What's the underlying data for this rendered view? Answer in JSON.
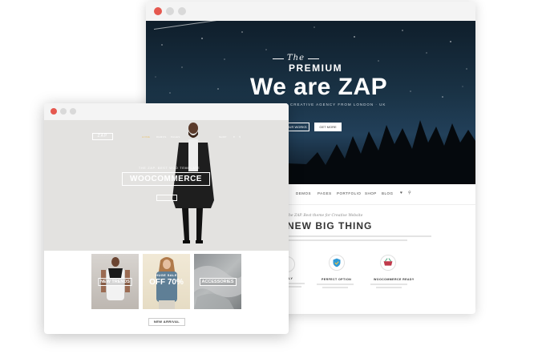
{
  "back_window": {
    "hero": {
      "script_text": "The",
      "premium": "PREMIUM",
      "headline": "We are ZAP",
      "tagline": "A CREATIVE AGENCY FROM LONDON · UK",
      "button_outline": "OUR WORKS",
      "button_fill": "GET MORE"
    },
    "nav": {
      "items": [
        "DEMOS",
        "PAGES",
        "PORTFOLIO",
        "SHOP",
        "BLOG"
      ],
      "icons": [
        "cart-icon",
        "search-icon"
      ]
    },
    "section": {
      "subtitle": "The ZAP. Best theme for Creative Website",
      "title": "NEW BIG THING",
      "features": [
        {
          "label": "FULLY",
          "icon": "support-icon"
        },
        {
          "label": "PERFECT OPTION",
          "icon": "shield-icon"
        },
        {
          "label": "WOOCOMMERCE READY",
          "icon": "basket-icon"
        }
      ]
    }
  },
  "front_window": {
    "logo": "ZAP",
    "nav": [
      "HOME",
      "DEMOS",
      "PAGES",
      "SHOP"
    ],
    "hero": {
      "subtitle": "THE ZAP. BEST WOO TEMPLATE",
      "title": "WOOCOMMERCE",
      "button": "SHOP NOW"
    },
    "tiles": [
      {
        "label": "NEW TRENDS"
      },
      {
        "sale_small": "HUGE SALE",
        "sale_big": "OFF 70%"
      },
      {
        "label": "ACCESSORIES"
      }
    ],
    "section_button": "NEW ARRIVAL"
  },
  "colors": {
    "dot_red": "#e5584f",
    "dot_grey": "#d9d9d9",
    "accent_gold": "#e8c57a"
  }
}
